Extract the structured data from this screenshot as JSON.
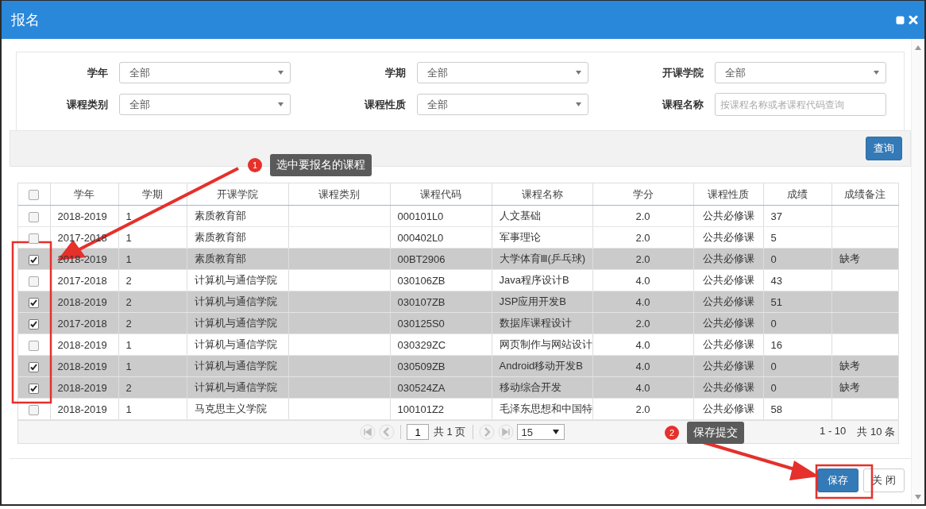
{
  "window": {
    "title": "报名"
  },
  "filters": [
    {
      "label": "学年",
      "kind": "select",
      "value": "全部"
    },
    {
      "label": "学期",
      "kind": "select",
      "value": "全部"
    },
    {
      "label": "开课学院",
      "kind": "select",
      "value": "全部"
    },
    {
      "label": "课程类别",
      "kind": "select",
      "value": "全部"
    },
    {
      "label": "课程性质",
      "kind": "select",
      "value": "全部"
    },
    {
      "label": "课程名称",
      "kind": "text",
      "placeholder": "按课程名称或者课程代码查询"
    }
  ],
  "toolbar": {
    "search_button": "查询"
  },
  "table": {
    "header_checked": false,
    "columns": [
      "学年",
      "学期",
      "开课学院",
      "课程类别",
      "课程代码",
      "课程名称",
      "学分",
      "课程性质",
      "成绩",
      "成绩备注"
    ],
    "rows": [
      {
        "selected": false,
        "cells": [
          "2018-2019",
          "1",
          "素质教育部",
          "",
          "000101L0",
          "人文基础",
          "2.0",
          "公共必修课",
          "37",
          ""
        ]
      },
      {
        "selected": false,
        "cells": [
          "2017-2018",
          "1",
          "素质教育部",
          "",
          "000402L0",
          "军事理论",
          "2.0",
          "公共必修课",
          "5",
          ""
        ]
      },
      {
        "selected": true,
        "cells": [
          "2018-2019",
          "1",
          "素质教育部",
          "",
          "00BT2906",
          "大学体育Ⅲ(乒乓球)",
          "2.0",
          "公共必修课",
          "0",
          "缺考"
        ]
      },
      {
        "selected": false,
        "cells": [
          "2017-2018",
          "2",
          "计算机与通信学院",
          "",
          "030106ZB",
          "Java程序设计B",
          "4.0",
          "公共必修课",
          "43",
          ""
        ]
      },
      {
        "selected": true,
        "cells": [
          "2018-2019",
          "2",
          "计算机与通信学院",
          "",
          "030107ZB",
          "JSP应用开发B",
          "4.0",
          "公共必修课",
          "51",
          ""
        ]
      },
      {
        "selected": true,
        "cells": [
          "2017-2018",
          "2",
          "计算机与通信学院",
          "",
          "030125S0",
          "数据库课程设计",
          "2.0",
          "公共必修课",
          "0",
          ""
        ]
      },
      {
        "selected": false,
        "cells": [
          "2018-2019",
          "1",
          "计算机与通信学院",
          "",
          "030329ZC",
          "网页制作与网站设计",
          "4.0",
          "公共必修课",
          "16",
          ""
        ]
      },
      {
        "selected": true,
        "cells": [
          "2018-2019",
          "1",
          "计算机与通信学院",
          "",
          "030509ZB",
          "Android移动开发B",
          "4.0",
          "公共必修课",
          "0",
          "缺考"
        ]
      },
      {
        "selected": true,
        "cells": [
          "2018-2019",
          "2",
          "计算机与通信学院",
          "",
          "030524ZA",
          "移动综合开发",
          "4.0",
          "公共必修课",
          "0",
          "缺考"
        ]
      },
      {
        "selected": false,
        "cells": [
          "2018-2019",
          "1",
          "马克思主义学院",
          "",
          "100101Z2",
          "毛泽东思想和中国特",
          "2.0",
          "公共必修课",
          "58",
          ""
        ]
      }
    ]
  },
  "pager": {
    "page": "1",
    "pages_text": "共 1 页",
    "page_size": "15",
    "range": "1 - 10",
    "total": "共 10 条"
  },
  "annotations": [
    {
      "number": "1",
      "text": "选中要报名的课程"
    },
    {
      "number": "2",
      "text": "保存提交"
    }
  ],
  "buttons": [
    {
      "label": "保存",
      "kind": "primary"
    },
    {
      "label": "关 闭",
      "kind": "default"
    }
  ]
}
